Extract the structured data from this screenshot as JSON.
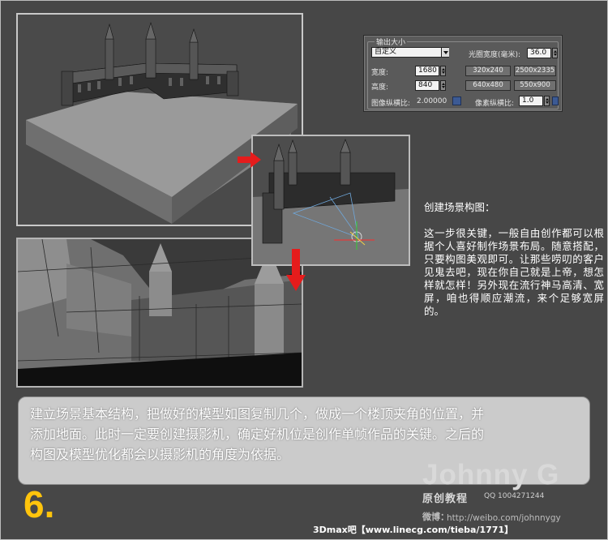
{
  "render_panel": {
    "group_title": "输出大小",
    "preset_value": "自定义",
    "aperture_label": "光圈宽度(毫米):",
    "aperture_value": "36.0",
    "width_label": "宽度:",
    "width_value": "1680",
    "height_label": "高度:",
    "height_value": "840",
    "presets": [
      "320x240",
      "2500x2335",
      "640x480",
      "550x900"
    ],
    "image_aspect_label": "图像纵横比:",
    "image_aspect_value": "2.00000",
    "pixel_aspect_label": "像素纵横比:",
    "pixel_aspect_value": "1.0"
  },
  "side_text": {
    "heading": "创建场景构图：",
    "body": "这一步很关键，一般自由创作都可以根据个人喜好制作场景布局。随意搭配，只要构图美观即可。让那些唠叨的客户见鬼去吧，现在你自己就是上帝，想怎样就怎样！另外现在流行神马高清、宽屏，咱也得顺应潮流，来个足够宽屏的。"
  },
  "banner": {
    "line1": "建立场景基本结构，把做好的模型如图复制几个，做成一个楼顶夹角的位置，并",
    "line2": "添加地面。此时一定要创建摄影机，确定好机位是创作单帧作品的关键。之后的",
    "line3": "构图及模型优化都会以摄影机的角度为依据。"
  },
  "step_number": "6.",
  "watermark": {
    "name": "Johnny G",
    "subtitle": "原创教程",
    "qq": "QQ 1004271244",
    "weibo_label": "微博：",
    "weibo_url": "http://weibo.com/johnnygy"
  },
  "footer": "3Dmax吧【www.linecg.com/tieba/1771】",
  "colors": {
    "background": "#474747",
    "step_number": "#ffc40c",
    "arrow": "#e51c1c"
  }
}
